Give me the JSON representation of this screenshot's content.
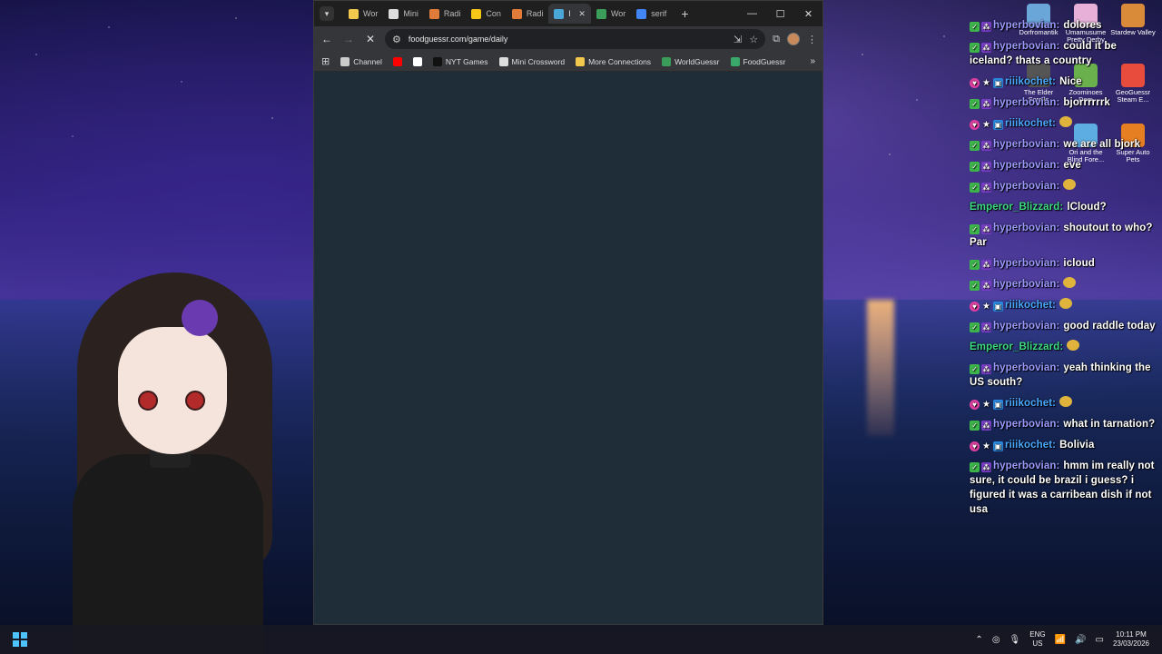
{
  "browser": {
    "tabs": [
      {
        "label": "Wor",
        "favicon": "#f2c94c"
      },
      {
        "label": "Mini",
        "favicon": "#dddddd"
      },
      {
        "label": "Radi",
        "favicon": "#e07b39"
      },
      {
        "label": "Con",
        "favicon": "#f5c518"
      },
      {
        "label": "Radi",
        "favicon": "#e07b39"
      },
      {
        "label": "l",
        "favicon": "#4aa8d8"
      },
      {
        "label": "Wor",
        "favicon": "#3a9e5a"
      },
      {
        "label": "serif",
        "favicon": "#4285f4"
      }
    ],
    "active_tab_index": 5,
    "url": "foodguessr.com/game/daily",
    "bookmarks": [
      {
        "label": "Channel",
        "icon": "folder-icon",
        "color": "#cccccc"
      },
      {
        "label": "",
        "icon": "youtube-icon",
        "color": "#ff0000"
      },
      {
        "label": "",
        "icon": "x-icon",
        "color": "#ffffff"
      },
      {
        "label": "NYT Games",
        "icon": "nyt-icon",
        "color": "#111111"
      },
      {
        "label": "Mini Crossword",
        "icon": "nyt-mini-icon",
        "color": "#dddddd"
      },
      {
        "label": "More Connections",
        "icon": "grid-icon",
        "color": "#f2c94c"
      },
      {
        "label": "WorldGuessr",
        "icon": "globe-icon",
        "color": "#3a9e5a"
      },
      {
        "label": "FoodGuessr",
        "icon": "food-icon",
        "color": "#3aa86b"
      }
    ]
  },
  "desktop_icons": [
    {
      "label": "Dorfromantik",
      "color": "#6aa6d8"
    },
    {
      "label": "Umamusume Pretty Derby",
      "color": "#e6b0d8"
    },
    {
      "label": "Stardew Valley",
      "color": "#d98b3a"
    },
    {
      "label": "The Elder Scrolls",
      "color": "#555555"
    },
    {
      "label": "Zoominoes Dem",
      "color": "#6ab04c"
    },
    {
      "label": "GeoGuessr Steam E...",
      "color": "#e74c3c"
    },
    {
      "label": "Ori and the Blind Fore...",
      "color": "#5dade2"
    },
    {
      "label": "Super Auto Pets",
      "color": "#e67e22"
    }
  ],
  "chat": [
    {
      "user": "hyperbovian",
      "color": "#9b9bff",
      "badges": [
        "check",
        "sub"
      ],
      "text": "dolores"
    },
    {
      "user": "hyperbovian",
      "color": "#9b9bff",
      "badges": [
        "check",
        "sub"
      ],
      "text": "could it be iceland? thats a country"
    },
    {
      "user": "riiikochet",
      "color": "#4aa8ff",
      "badges": [
        "heart",
        "star",
        "prime"
      ],
      "text": "Nice"
    },
    {
      "user": "hyperbovian",
      "color": "#9b9bff",
      "badges": [
        "check",
        "sub"
      ],
      "text": "bjorrrrrrk"
    },
    {
      "user": "riiikochet",
      "color": "#4aa8ff",
      "badges": [
        "heart",
        "star",
        "prime"
      ],
      "text": ""
    },
    {
      "user": "hyperbovian",
      "color": "#9b9bff",
      "badges": [
        "check",
        "sub"
      ],
      "text": "we are all bjork"
    },
    {
      "user": "hyperbovian",
      "color": "#9b9bff",
      "badges": [
        "check",
        "sub"
      ],
      "text": "eve"
    },
    {
      "user": "hyperbovian",
      "color": "#9b9bff",
      "badges": [
        "check",
        "sub"
      ],
      "text": ""
    },
    {
      "user": "Emperor_Blizzard",
      "color": "#3ddc84",
      "badges": [],
      "text": "lCloud?"
    },
    {
      "user": "hyperbovian",
      "color": "#9b9bff",
      "badges": [
        "check",
        "sub"
      ],
      "text": "shoutout to who? Par"
    },
    {
      "user": "hyperbovian",
      "color": "#9b9bff",
      "badges": [
        "check",
        "sub"
      ],
      "text": "icloud"
    },
    {
      "user": "hyperbovian",
      "color": "#9b9bff",
      "badges": [
        "check",
        "sub"
      ],
      "text": ""
    },
    {
      "user": "riiikochet",
      "color": "#4aa8ff",
      "badges": [
        "heart",
        "star",
        "prime"
      ],
      "text": ""
    },
    {
      "user": "hyperbovian",
      "color": "#9b9bff",
      "badges": [
        "check",
        "sub"
      ],
      "text": "good raddle today"
    },
    {
      "user": "Emperor_Blizzard",
      "color": "#3ddc84",
      "badges": [],
      "text": ""
    },
    {
      "user": "hyperbovian",
      "color": "#9b9bff",
      "badges": [
        "check",
        "sub"
      ],
      "text": "yeah thinking the US south?"
    },
    {
      "user": "riiikochet",
      "color": "#4aa8ff",
      "badges": [
        "heart",
        "star",
        "prime"
      ],
      "text": ""
    },
    {
      "user": "hyperbovian",
      "color": "#9b9bff",
      "badges": [
        "check",
        "sub"
      ],
      "text": "what in tarnation?"
    },
    {
      "user": "riiikochet",
      "color": "#4aa8ff",
      "badges": [
        "heart",
        "star",
        "prime"
      ],
      "text": "Bolivia"
    },
    {
      "user": "hyperbovian",
      "color": "#9b9bff",
      "badges": [
        "check",
        "sub"
      ],
      "text": "hmm im really not sure, it could be brazil i guess? i figured it was a carribean dish if not usa"
    }
  ],
  "taskbar": {
    "lang_top": "ENG",
    "lang_bottom": "US",
    "time": "10:11 PM",
    "date": "23/03/2026"
  }
}
